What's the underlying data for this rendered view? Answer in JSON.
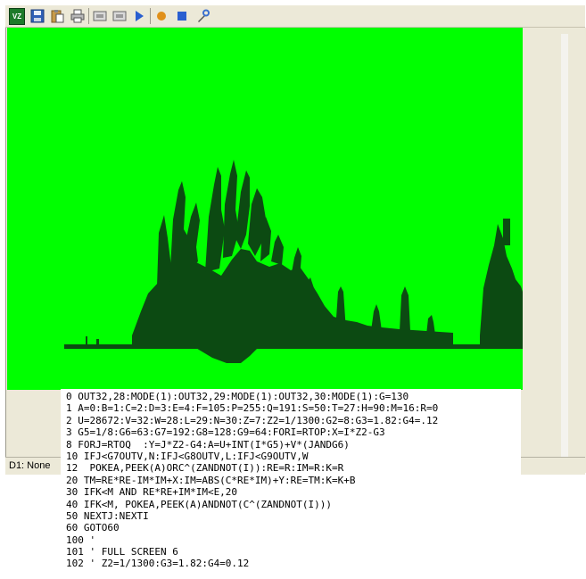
{
  "toolbar": {
    "buttons": [
      {
        "icon": "vz-logo-icon",
        "label": "VZ"
      },
      {
        "icon": "save-icon"
      },
      {
        "icon": "paste-icon"
      },
      {
        "icon": "print-icon"
      },
      {
        "icon": "tape-icon"
      },
      {
        "icon": "tape-icon"
      },
      {
        "icon": "play-icon"
      },
      {
        "icon": "record-icon"
      },
      {
        "icon": "stop-icon"
      },
      {
        "icon": "tools-icon"
      }
    ]
  },
  "screen": {
    "background_color": "#00ff00",
    "foreground_color": "#0c4a12"
  },
  "status": {
    "text": "D1: None"
  },
  "code": {
    "lines": [
      "0 OUT32,28:MODE(1):OUT32,29:MODE(1):OUT32,30:MODE(1):G=130",
      "1 A=0:B=1:C=2:D=3:E=4:F=105:P=255:Q=191:S=50:T=27:H=90:M=16:R=0",
      "2 U=28672:V=32:W=28:L=29:N=30:Z=7:Z2=1/1300:G2=8:G3=1.82:G4=.12",
      "3 G5=1/8:G6=63:G7=192:G8=128:G9=64:FORI=RTOP:X=I*Z2-G3",
      "8 FORJ=RTOQ  :Y=J*Z2-G4:A=U+INT(I*G5)+V*(JANDG6)",
      "10 IFJ<G7OUTV,N:IFJ<G8OUTV,L:IFJ<G9OUTV,W",
      "12  POKEA,PEEK(A)ORC^(ZANDNOT(I)):RE=R:IM=R:K=R",
      "20 TM=RE*RE-IM*IM+X:IM=ABS(C*RE*IM)+Y:RE=TM:K=K+B",
      "30 IFK<M AND RE*RE+IM*IM<E,20",
      "40 IFK<M, POKEA,PEEK(A)ANDNOT(C^(ZANDNOT(I)))",
      "50 NEXTJ:NEXTI",
      "60 GOTO60",
      "100 '",
      "101 ' FULL SCREEN 6",
      "102 ' Z2=1/1300:G3=1.82:G4=0.12"
    ]
  }
}
